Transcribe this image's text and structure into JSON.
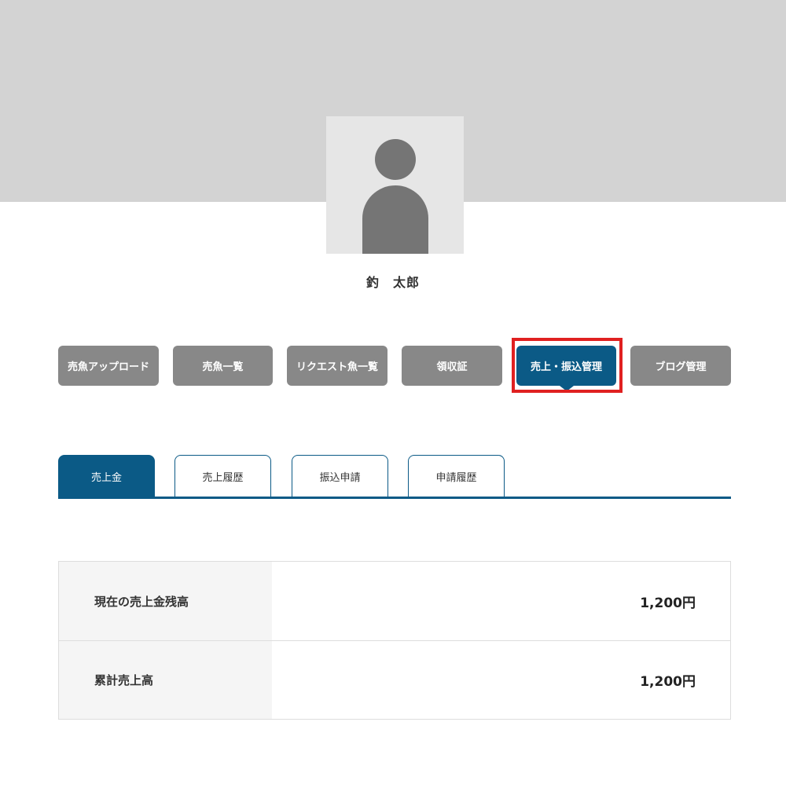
{
  "profile": {
    "name": "釣　太郎"
  },
  "menu": {
    "items": [
      {
        "label": "売魚アップロード"
      },
      {
        "label": "売魚一覧"
      },
      {
        "label": "リクエスト魚一覧"
      },
      {
        "label": "領収証"
      },
      {
        "label": "売上・振込管理",
        "active": true
      },
      {
        "label": "ブログ管理"
      }
    ],
    "accent_color": "#0b5a86",
    "highlight_color": "#e02020"
  },
  "tabs": [
    {
      "label": "売上金",
      "active": true
    },
    {
      "label": "売上履歴"
    },
    {
      "label": "振込申請"
    },
    {
      "label": "申請履歴"
    }
  ],
  "summary": {
    "rows": [
      {
        "label": "現在の売上金残高",
        "value": "1,200円"
      },
      {
        "label": "累計売上高",
        "value": "1,200円"
      }
    ]
  }
}
